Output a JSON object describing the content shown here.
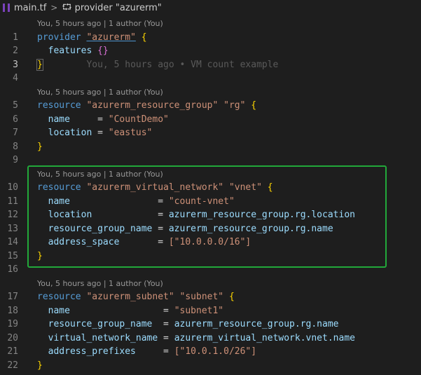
{
  "breadcrumb": {
    "file": "main.tf",
    "symbol": "provider \"azurerm\""
  },
  "blame": {
    "lens": "You, 5 hours ago | 1 author (You)",
    "inline": "You, 5 hours ago • VM count example"
  },
  "lines": {
    "l1": {
      "n": "1",
      "kw": "provider",
      "name": "\"azurerm\"",
      "brace": "{"
    },
    "l2": {
      "n": "2",
      "text": "features",
      "brace": "{}"
    },
    "l3": {
      "n": "3",
      "brace": "}"
    },
    "l4": {
      "n": "4"
    },
    "l5": {
      "n": "5",
      "kw": "resource",
      "type": "\"azurerm_resource_group\"",
      "name": "\"rg\"",
      "brace": "{"
    },
    "l6": {
      "n": "6",
      "key": "name",
      "eq": "     = ",
      "val": "\"CountDemo\""
    },
    "l7": {
      "n": "7",
      "key": "location",
      "eq": " = ",
      "val": "\"eastus\""
    },
    "l8": {
      "n": "8",
      "brace": "}"
    },
    "l9": {
      "n": "9"
    },
    "l10": {
      "n": "10",
      "kw": "resource",
      "type": "\"azurerm_virtual_network\"",
      "name": "\"vnet\"",
      "brace": "{"
    },
    "l11": {
      "n": "11",
      "key": "name",
      "eq": "                = ",
      "val": "\"count-vnet\""
    },
    "l12": {
      "n": "12",
      "key": "location",
      "eq": "            = ",
      "val": "azurerm_resource_group.rg.location"
    },
    "l13": {
      "n": "13",
      "key": "resource_group_name",
      "eq": " = ",
      "val": "azurerm_resource_group.rg.name"
    },
    "l14": {
      "n": "14",
      "key": "address_space",
      "eq": "       = ",
      "val": "[\"10.0.0.0/16\"]"
    },
    "l15": {
      "n": "15",
      "brace": "}"
    },
    "l16": {
      "n": "16"
    },
    "l17": {
      "n": "17",
      "kw": "resource",
      "type": "\"azurerm_subnet\"",
      "name": "\"subnet\"",
      "brace": "{"
    },
    "l18": {
      "n": "18",
      "key": "name",
      "eq": "                 = ",
      "val": "\"subnet1\""
    },
    "l19": {
      "n": "19",
      "key": "resource_group_name",
      "eq": "  = ",
      "val": "azurerm_resource_group.rg.name"
    },
    "l20": {
      "n": "20",
      "key": "virtual_network_name",
      "eq": " = ",
      "val": "azurerm_virtual_network.vnet.name"
    },
    "l21": {
      "n": "21",
      "key": "address_prefixes",
      "eq": "     = ",
      "val": "[\"10.0.1.0/26\"]"
    },
    "l22": {
      "n": "22",
      "brace": "}"
    }
  },
  "colors": {
    "highlight_border": "#22a83a",
    "keyword": "#569cd6",
    "string": "#ce9178",
    "property": "#9cdcfe",
    "brace": "#ffd700"
  }
}
